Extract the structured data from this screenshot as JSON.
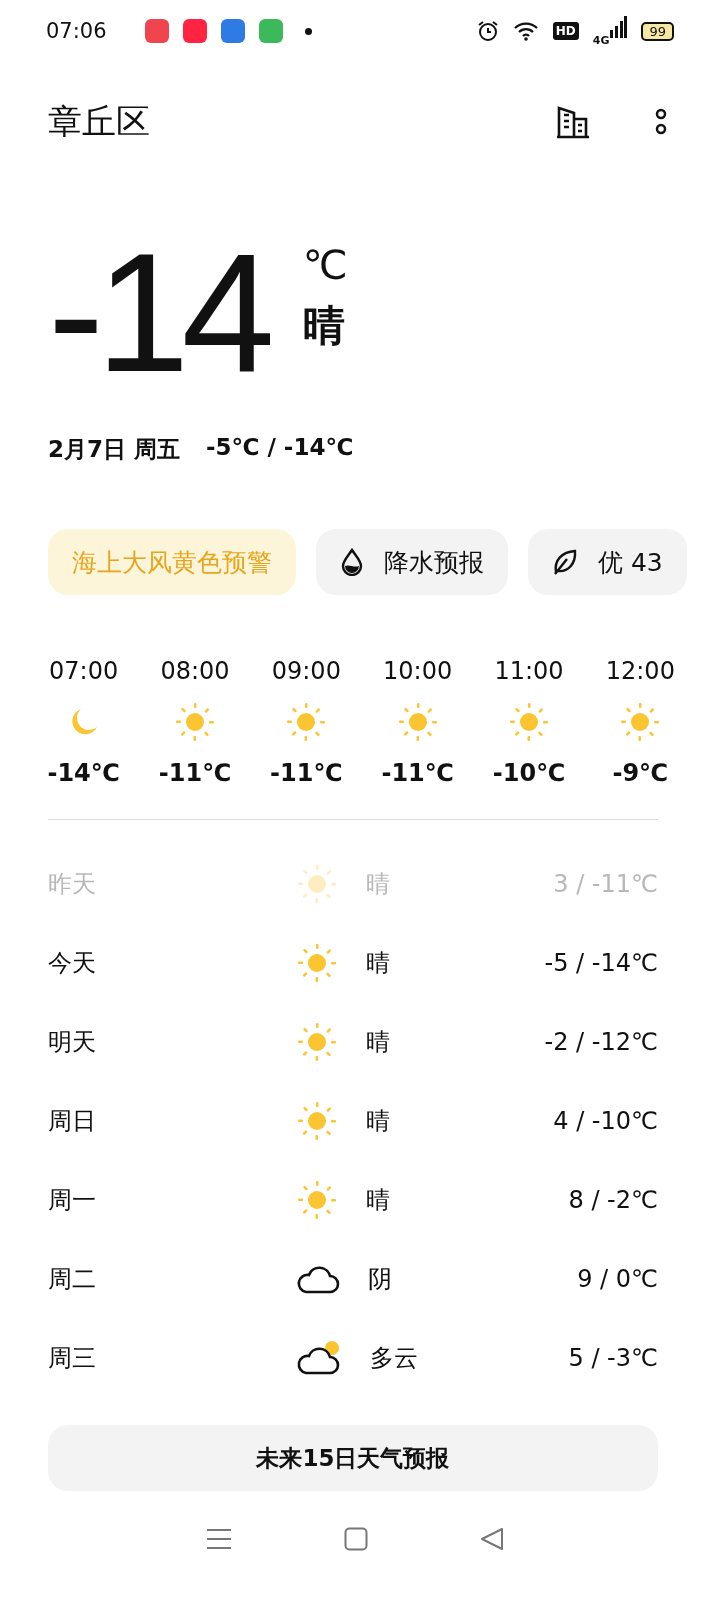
{
  "status_bar": {
    "time": "07:06",
    "network": "4G",
    "hd": "HD",
    "battery": "99"
  },
  "header": {
    "location": "章丘区"
  },
  "current": {
    "temperature": "-14",
    "unit": "℃",
    "condition": "晴",
    "date": "2月7日 周五",
    "range": "-5℃ / -14℃"
  },
  "chips": [
    {
      "kind": "warning",
      "label": "海上大风黄色预警"
    },
    {
      "kind": "rain",
      "label": "降水预报"
    },
    {
      "kind": "air",
      "label": "优 43"
    }
  ],
  "hourly": [
    {
      "time": "07:00",
      "kind": "moon",
      "temp": "-14℃"
    },
    {
      "time": "08:00",
      "kind": "sun",
      "temp": "-11℃"
    },
    {
      "time": "09:00",
      "kind": "sun",
      "temp": "-11℃"
    },
    {
      "time": "10:00",
      "kind": "sun",
      "temp": "-11℃"
    },
    {
      "time": "11:00",
      "kind": "sun",
      "temp": "-10℃"
    },
    {
      "time": "12:00",
      "kind": "sun",
      "temp": "-9℃"
    }
  ],
  "daily": [
    {
      "day": "昨天",
      "kind": "sun",
      "condition": "晴",
      "range": "3 / -11℃",
      "past": true
    },
    {
      "day": "今天",
      "kind": "sun",
      "condition": "晴",
      "range": "-5 / -14℃",
      "past": false
    },
    {
      "day": "明天",
      "kind": "sun",
      "condition": "晴",
      "range": "-2 / -12℃",
      "past": false
    },
    {
      "day": "周日",
      "kind": "sun",
      "condition": "晴",
      "range": "4 / -10℃",
      "past": false
    },
    {
      "day": "周一",
      "kind": "sun",
      "condition": "晴",
      "range": "8 / -2℃",
      "past": false
    },
    {
      "day": "周二",
      "kind": "cloud",
      "condition": "阴",
      "range": "9 / 0℃",
      "past": false
    },
    {
      "day": "周三",
      "kind": "partly-cloudy",
      "condition": "多云",
      "range": "5 / -3℃",
      "past": false
    }
  ],
  "forecast_button": "未来15日天气预报"
}
